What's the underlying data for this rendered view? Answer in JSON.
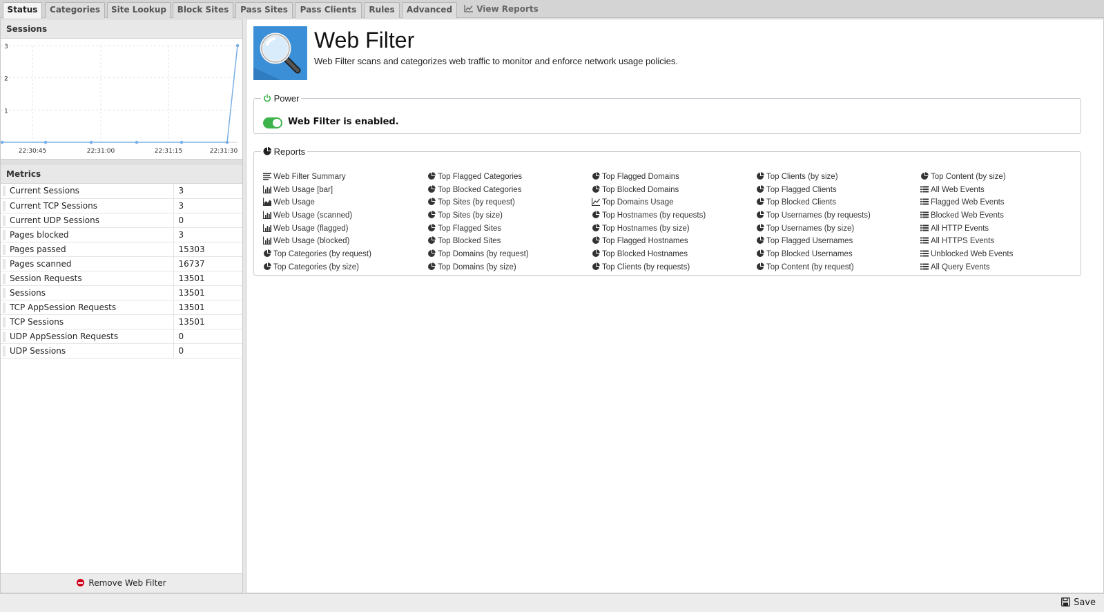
{
  "tabs": [
    {
      "label": "Status",
      "active": true
    },
    {
      "label": "Categories"
    },
    {
      "label": "Site Lookup"
    },
    {
      "label": "Block Sites"
    },
    {
      "label": "Pass Sites"
    },
    {
      "label": "Pass Clients"
    },
    {
      "label": "Rules"
    },
    {
      "label": "Advanced"
    },
    {
      "label": "View Reports",
      "icon": "line-chart-icon"
    }
  ],
  "sessions": {
    "title": "Sessions",
    "chart_data": {
      "type": "line",
      "x": [
        "22:30:40",
        "22:30:45",
        "22:30:50",
        "22:30:55",
        "22:31:00",
        "22:31:05",
        "22:31:10",
        "22:31:15",
        "22:31:20",
        "22:31:25",
        "22:31:30",
        "22:31:31"
      ],
      "x_tick_labels": [
        "22:30:45",
        "22:31:00",
        "22:31:15",
        "22:31:30"
      ],
      "values": [
        0,
        0,
        0,
        0,
        0,
        0,
        0,
        0,
        0,
        0,
        0,
        3
      ],
      "y_ticks": [
        "1",
        "2",
        "3"
      ],
      "ylim": [
        0,
        3
      ],
      "grid": true,
      "color": "#7ab0e6"
    }
  },
  "metrics": {
    "title": "Metrics",
    "rows": [
      {
        "label": "Current Sessions",
        "value": "3"
      },
      {
        "label": "Current TCP Sessions",
        "value": "3"
      },
      {
        "label": "Current UDP Sessions",
        "value": "0"
      },
      {
        "label": "Pages blocked",
        "value": "3"
      },
      {
        "label": "Pages passed",
        "value": "15303"
      },
      {
        "label": "Pages scanned",
        "value": "16737"
      },
      {
        "label": "Session Requests",
        "value": "13501"
      },
      {
        "label": "Sessions",
        "value": "13501"
      },
      {
        "label": "TCP AppSession Requests",
        "value": "13501"
      },
      {
        "label": "TCP Sessions",
        "value": "13501"
      },
      {
        "label": "UDP AppSession Requests",
        "value": "0"
      },
      {
        "label": "UDP Sessions",
        "value": "0"
      }
    ]
  },
  "remove_label": "Remove Web Filter",
  "app": {
    "title": "Web Filter",
    "description": "Web Filter scans and categorizes web traffic to monitor and enforce network usage policies.",
    "icon": "magnifier-icon"
  },
  "power": {
    "legend": "Power",
    "status_text": "Web Filter is enabled.",
    "enabled": true,
    "toggle_color": "#3cb44b"
  },
  "reports": {
    "legend": "Reports",
    "columns": [
      [
        {
          "label": "Web Filter Summary",
          "icon": "text-icon"
        },
        {
          "label": "Web Usage [bar]",
          "icon": "bar-chart-icon"
        },
        {
          "label": "Web Usage",
          "icon": "area-chart-icon"
        },
        {
          "label": "Web Usage (scanned)",
          "icon": "bar-chart-icon"
        },
        {
          "label": "Web Usage (flagged)",
          "icon": "bar-chart-icon"
        },
        {
          "label": "Web Usage (blocked)",
          "icon": "bar-chart-icon"
        },
        {
          "label": "Top Categories (by request)",
          "icon": "pie-chart-icon"
        },
        {
          "label": "Top Categories (by size)",
          "icon": "pie-chart-icon"
        }
      ],
      [
        {
          "label": "Top Flagged Categories",
          "icon": "pie-chart-icon"
        },
        {
          "label": "Top Blocked Categories",
          "icon": "pie-chart-icon"
        },
        {
          "label": "Top Sites (by request)",
          "icon": "pie-chart-icon"
        },
        {
          "label": "Top Sites (by size)",
          "icon": "pie-chart-icon"
        },
        {
          "label": "Top Flagged Sites",
          "icon": "pie-chart-icon"
        },
        {
          "label": "Top Blocked Sites",
          "icon": "pie-chart-icon"
        },
        {
          "label": "Top Domains (by request)",
          "icon": "pie-chart-icon"
        },
        {
          "label": "Top Domains (by size)",
          "icon": "pie-chart-icon"
        }
      ],
      [
        {
          "label": "Top Flagged Domains",
          "icon": "pie-chart-icon"
        },
        {
          "label": "Top Blocked Domains",
          "icon": "pie-chart-icon"
        },
        {
          "label": "Top Domains Usage",
          "icon": "line-chart-icon"
        },
        {
          "label": "Top Hostnames (by requests)",
          "icon": "pie-chart-icon"
        },
        {
          "label": "Top Hostnames (by size)",
          "icon": "pie-chart-icon"
        },
        {
          "label": "Top Flagged Hostnames",
          "icon": "pie-chart-icon"
        },
        {
          "label": "Top Blocked Hostnames",
          "icon": "pie-chart-icon"
        },
        {
          "label": "Top Clients (by requests)",
          "icon": "pie-chart-icon"
        }
      ],
      [
        {
          "label": "Top Clients (by size)",
          "icon": "pie-chart-icon"
        },
        {
          "label": "Top Flagged Clients",
          "icon": "pie-chart-icon"
        },
        {
          "label": "Top Blocked Clients",
          "icon": "pie-chart-icon"
        },
        {
          "label": "Top Usernames (by requests)",
          "icon": "pie-chart-icon"
        },
        {
          "label": "Top Usernames (by size)",
          "icon": "pie-chart-icon"
        },
        {
          "label": "Top Flagged Usernames",
          "icon": "pie-chart-icon"
        },
        {
          "label": "Top Blocked Usernames",
          "icon": "pie-chart-icon"
        },
        {
          "label": "Top Content (by request)",
          "icon": "pie-chart-icon"
        }
      ],
      [
        {
          "label": "Top Content (by size)",
          "icon": "pie-chart-icon"
        },
        {
          "label": "All Web Events",
          "icon": "list-icon"
        },
        {
          "label": "Flagged Web Events",
          "icon": "list-icon"
        },
        {
          "label": "Blocked Web Events",
          "icon": "list-icon"
        },
        {
          "label": "All HTTP Events",
          "icon": "list-icon"
        },
        {
          "label": "All HTTPS Events",
          "icon": "list-icon"
        },
        {
          "label": "Unblocked Web Events",
          "icon": "list-icon"
        },
        {
          "label": "All Query Events",
          "icon": "list-icon"
        }
      ]
    ]
  },
  "save_label": "Save"
}
